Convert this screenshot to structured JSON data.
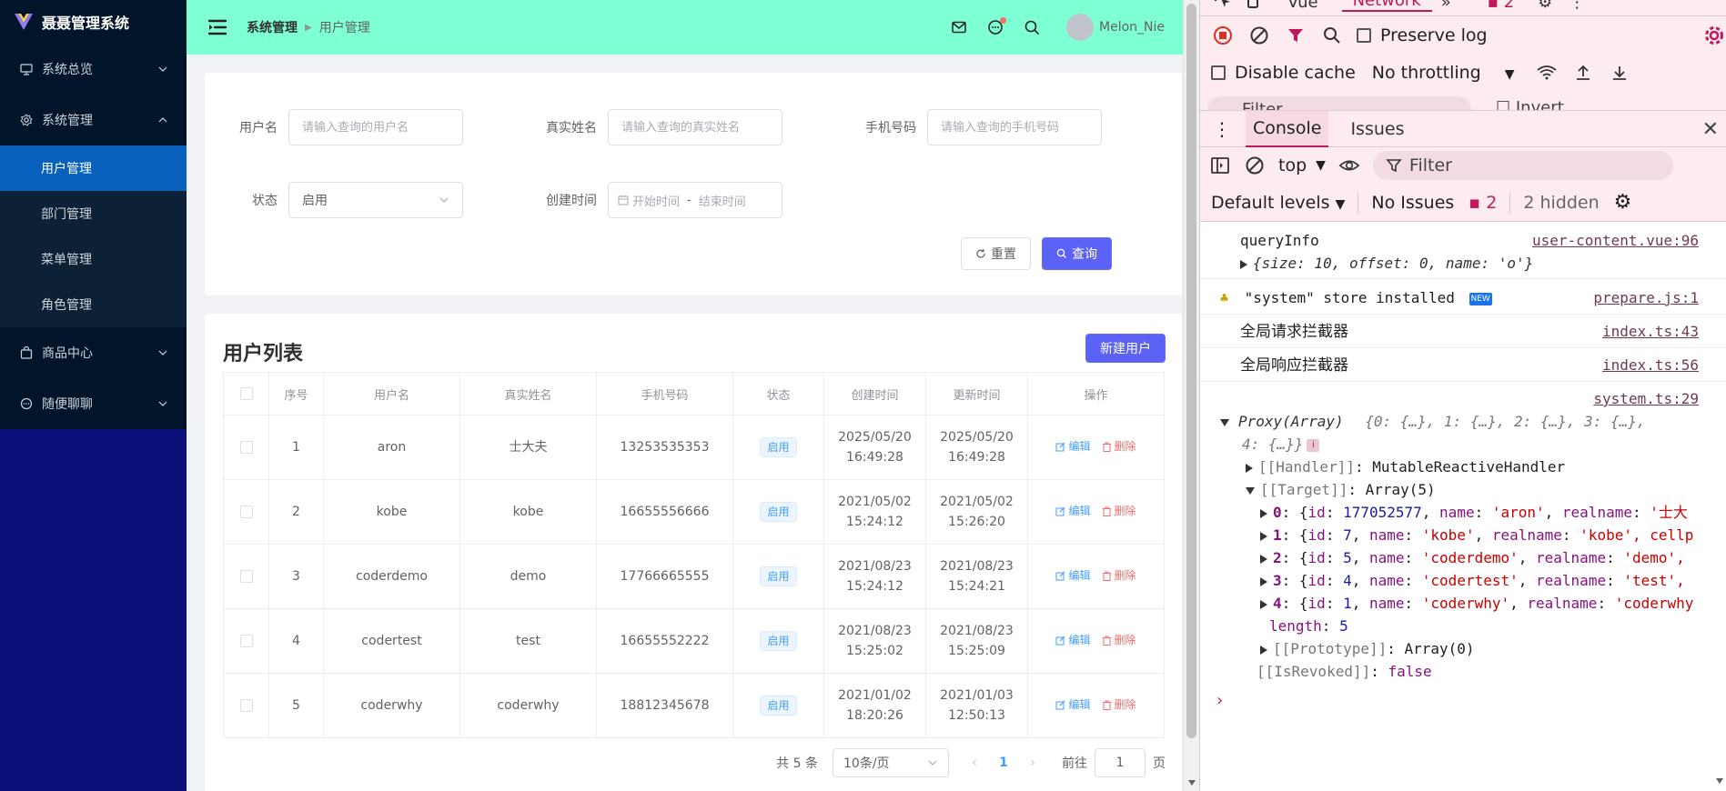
{
  "app": {
    "title": "聂聂管理系统",
    "sidebar": {
      "groups": [
        {
          "label": "系统总览",
          "icon": "monitor-icon"
        },
        {
          "label": "系统管理",
          "icon": "gear-icon"
        },
        {
          "label": "商品中心",
          "icon": "bag-icon"
        },
        {
          "label": "随便聊聊",
          "icon": "chat-icon"
        }
      ],
      "items": [
        {
          "label": "用户管理",
          "active": true
        },
        {
          "label": "部门管理"
        },
        {
          "label": "菜单管理"
        },
        {
          "label": "角色管理"
        }
      ]
    },
    "header": {
      "breadcrumb": [
        "系统管理",
        "用户管理"
      ],
      "breadcrumb_sep": "▶",
      "username": "Melon_Nie"
    },
    "search": {
      "username_label": "用户名",
      "username_placeholder": "请输入查询的用户名",
      "realname_label": "真实姓名",
      "realname_placeholder": "请输入查询的真实姓名",
      "phone_label": "手机号码",
      "phone_placeholder": "请输入查询的手机号码",
      "status_label": "状态",
      "status_value": "启用",
      "created_label": "创建时间",
      "date_start": "开始时间",
      "date_sep": "-",
      "date_end": "结束时间",
      "reset_label": "重置",
      "query_label": "查询"
    },
    "table": {
      "title": "用户列表",
      "new_label": "新建用户",
      "columns": [
        "序号",
        "用户名",
        "真实姓名",
        "手机号码",
        "状态",
        "创建时间",
        "更新时间",
        "操作"
      ],
      "edit_label": "编辑",
      "delete_label": "删除",
      "rows": [
        {
          "index": "1",
          "name": "aron",
          "realname": "士大夫",
          "phone": "13253535353",
          "status": "启用",
          "created_date": "2025/05/20",
          "created_time": "16:49:28",
          "updated_date": "2025/05/20",
          "updated_time": "16:49:28"
        },
        {
          "index": "2",
          "name": "kobe",
          "realname": "kobe",
          "phone": "16655556666",
          "status": "启用",
          "created_date": "2021/05/02",
          "created_time": "15:24:12",
          "updated_date": "2021/05/02",
          "updated_time": "15:26:20"
        },
        {
          "index": "3",
          "name": "coderdemo",
          "realname": "demo",
          "phone": "17766665555",
          "status": "启用",
          "created_date": "2021/08/23",
          "created_time": "15:24:12",
          "updated_date": "2021/08/23",
          "updated_time": "15:24:21"
        },
        {
          "index": "4",
          "name": "codertest",
          "realname": "test",
          "phone": "16655552222",
          "status": "启用",
          "created_date": "2021/08/23",
          "created_time": "15:25:02",
          "updated_date": "2021/08/23",
          "updated_time": "15:25:09"
        },
        {
          "index": "5",
          "name": "coderwhy",
          "realname": "coderwhy",
          "phone": "18812345678",
          "status": "启用",
          "created_date": "2021/01/02",
          "created_time": "18:20:26",
          "updated_date": "2021/01/03",
          "updated_time": "12:50:13"
        }
      ]
    },
    "pagination": {
      "total": "共 5 条",
      "page_size": "10条/页",
      "current_page": "1",
      "goto_prefix": "前往",
      "goto_value": "1",
      "goto_suffix": "页"
    }
  },
  "devtools": {
    "tabs": [
      "Vue",
      "Network"
    ],
    "tab_badge": "2",
    "network_bar": {
      "preserve_log": "Preserve log",
      "disable_cache": "Disable cache",
      "throttling": "No throttling",
      "filter_peek": "Filter",
      "invert_peek": "Invert"
    },
    "drawer_tabs": [
      "Console",
      "Issues"
    ],
    "console_bar": {
      "context": "top",
      "filter_placeholder": "Filter",
      "levels": "Default levels",
      "issues": "No Issues",
      "badge_count": "2",
      "hidden": "2 hidden"
    },
    "logs": {
      "query_label": "queryInfo",
      "query_src": "user-content.vue:96",
      "query_obj": "{size: 10, offset: 0, name: 'o'}",
      "store_text": "\"system\" store installed",
      "store_new": "NEW",
      "store_src": "prepare.js:1",
      "req_text": "全局请求拦截器",
      "req_src": "index.ts:43",
      "resp_text": "全局响应拦截器",
      "resp_src": "index.ts:56",
      "proxy_src": "system.ts:29",
      "proxy_head": "Proxy(Array)",
      "proxy_summary": "{0: {…}, 1: {…}, 2: {…}, 3: {…},",
      "proxy_summary2": "4: {…}}",
      "handler_key": "[[Handler]]",
      "handler_val": "MutableReactiveHandler",
      "target_key": "[[Target]]",
      "target_val": "Array(5)",
      "items": [
        {
          "k": "0",
          "id": "177052577",
          "name": "'aron'",
          "realname": "'士大"
        },
        {
          "k": "1",
          "id": "7",
          "name": "'kobe'",
          "realname": "'kobe', cellp"
        },
        {
          "k": "2",
          "id": "5",
          "name": "'coderdemo'",
          "realname": "'demo',"
        },
        {
          "k": "3",
          "id": "4",
          "name": "'codertest'",
          "realname": "'test',"
        },
        {
          "k": "4",
          "id": "1",
          "name": "'coderwhy'",
          "realname": "'coderwhy"
        }
      ],
      "length_key": "length",
      "length_val": "5",
      "proto_key": "[[Prototype]]",
      "proto_val": "Array(0)",
      "revoked_key": "[[IsRevoked]]",
      "revoked_val": "false"
    }
  },
  "colors": {
    "sidebar_bg": "#0c107a",
    "header_bg": "#7fffd4",
    "active_menu": "#0a60bd",
    "primary": "#5b62f5",
    "devtools_accent": "#c2185b"
  }
}
